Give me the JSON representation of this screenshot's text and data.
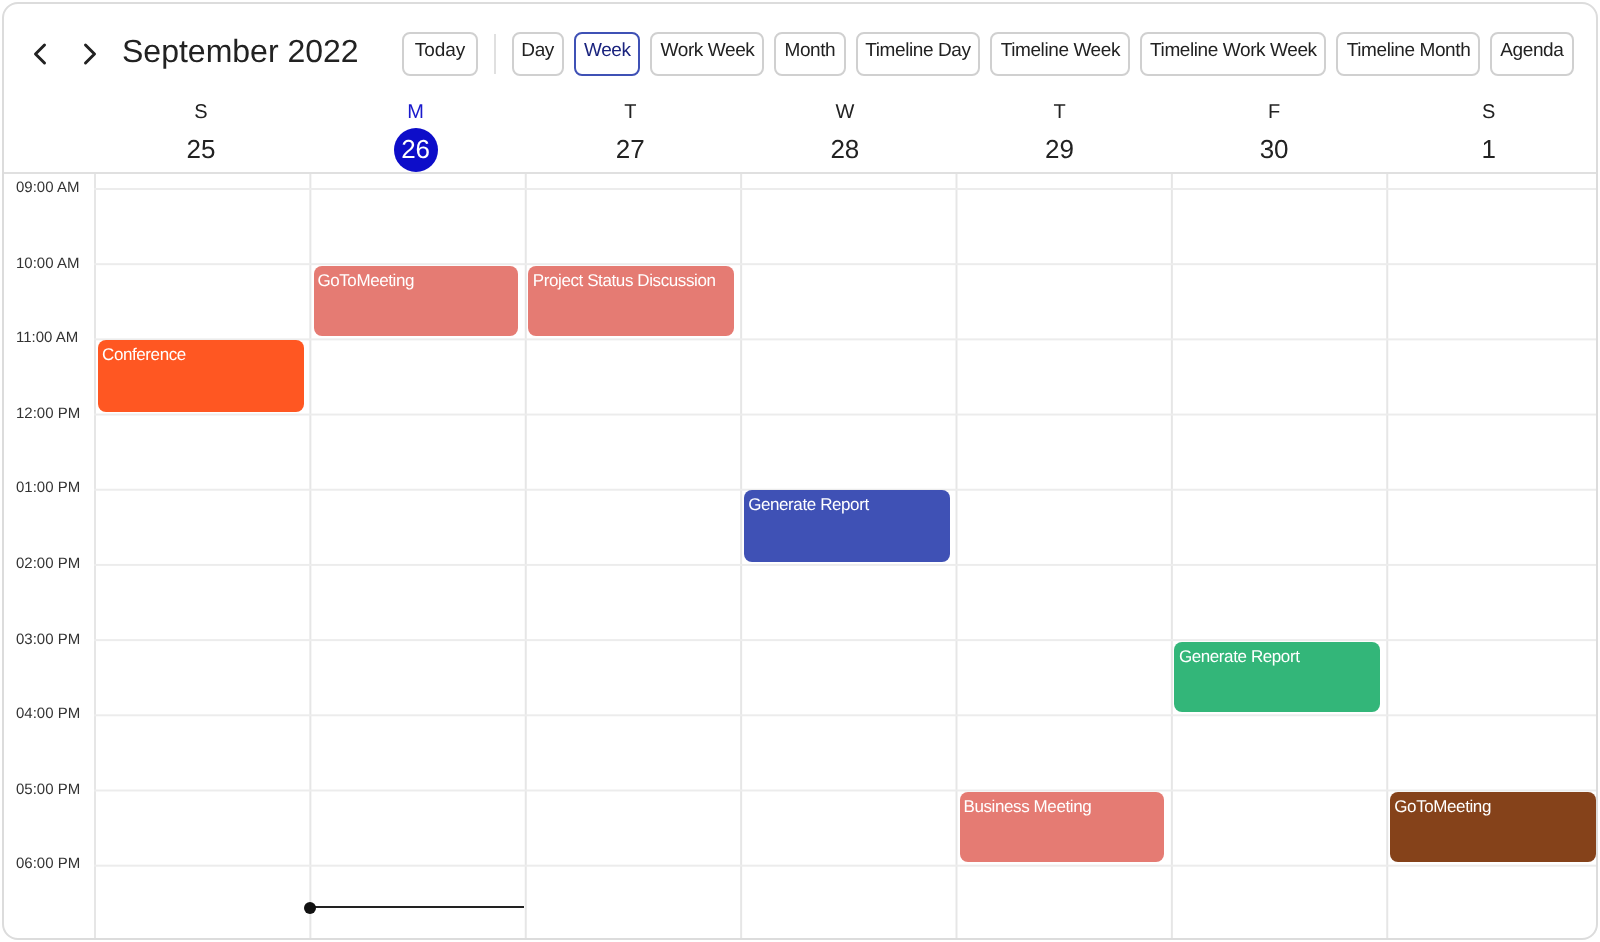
{
  "header": {
    "title": "September 2022",
    "today_button": "Today"
  },
  "views": [
    {
      "label": "Day",
      "selected": false
    },
    {
      "label": "Week",
      "selected": true
    },
    {
      "label": "Work Week",
      "selected": false
    },
    {
      "label": "Month",
      "selected": false
    },
    {
      "label": "Timeline Day",
      "selected": false
    },
    {
      "label": "Timeline Week",
      "selected": false
    },
    {
      "label": "Timeline Work Week",
      "selected": false
    },
    {
      "label": "Timeline Month",
      "selected": false
    },
    {
      "label": "Agenda",
      "selected": false
    }
  ],
  "days": [
    {
      "weekday": "S",
      "date": "25",
      "selected": false
    },
    {
      "weekday": "M",
      "date": "26",
      "selected": true
    },
    {
      "weekday": "T",
      "date": "27",
      "selected": false
    },
    {
      "weekday": "W",
      "date": "28",
      "selected": false
    },
    {
      "weekday": "T",
      "date": "29",
      "selected": false
    },
    {
      "weekday": "F",
      "date": "30",
      "selected": false
    },
    {
      "weekday": "S",
      "date": "1",
      "selected": false
    }
  ],
  "times": [
    {
      "label": "09:00 AM",
      "cells": [
        null,
        null,
        null,
        null,
        null,
        null,
        null
      ]
    },
    {
      "label": "10:00 AM",
      "cells": [
        null,
        {
          "title": "GoToMeeting",
          "color": "#e57b73"
        },
        {
          "title": "Project Status Discussion",
          "color": "#e57b73"
        },
        null,
        null,
        null,
        null
      ]
    },
    {
      "label": "11:00 AM",
      "cells": [
        {
          "title": "Conference",
          "color": "#ff5722"
        },
        null,
        null,
        null,
        null,
        null,
        null
      ]
    },
    {
      "label": "12:00 PM",
      "cells": [
        null,
        null,
        null,
        null,
        null,
        null,
        null
      ]
    },
    {
      "label": "01:00 PM",
      "cells": [
        null,
        null,
        null,
        {
          "title": "Generate Report",
          "color": "#3f51b5"
        },
        null,
        null,
        null
      ]
    },
    {
      "label": "02:00 PM",
      "cells": [
        null,
        null,
        null,
        null,
        null,
        null,
        null
      ]
    },
    {
      "label": "03:00 PM",
      "cells": [
        null,
        null,
        null,
        null,
        null,
        {
          "title": "Generate Report",
          "color": "#33b679"
        },
        null
      ]
    },
    {
      "label": "04:00 PM",
      "cells": [
        null,
        null,
        null,
        null,
        null,
        null,
        null
      ]
    },
    {
      "label": "05:00 PM",
      "cells": [
        null,
        null,
        null,
        null,
        {
          "title": "Business Meeting",
          "color": "#e57b73"
        },
        null,
        {
          "title": "GoToMeeting",
          "color": "#85421a"
        }
      ]
    },
    {
      "label": "06:00 PM",
      "cells": [
        null,
        null,
        null,
        null,
        null,
        null,
        null
      ]
    }
  ]
}
